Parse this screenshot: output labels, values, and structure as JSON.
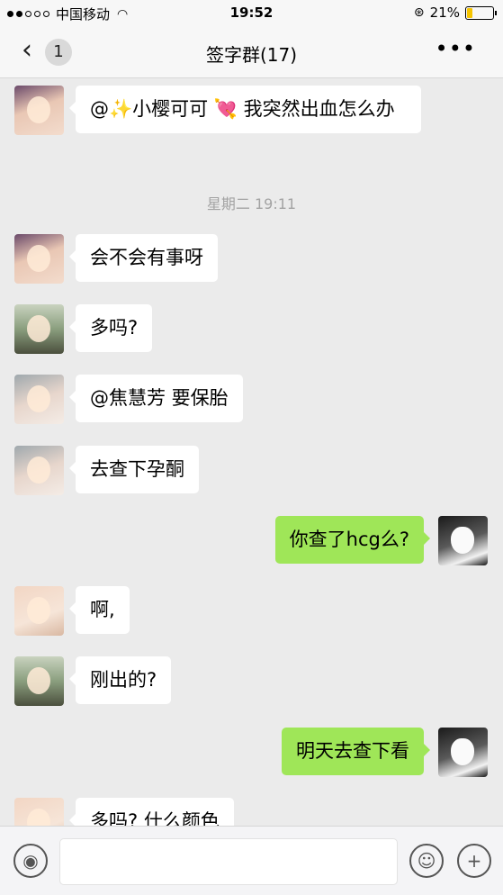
{
  "status_bar": {
    "carrier": "中国移动",
    "time": "19:52",
    "battery": "21%"
  },
  "nav": {
    "badge_count": "1",
    "title": "签字群(17)"
  },
  "chat": {
    "timestamp": "星期二 19:11",
    "messages": [
      {
        "side": "left",
        "avatar": "girl-avatar",
        "text": "@✨小樱可可 💘 我突然出血怎么办"
      },
      {
        "side": "left",
        "avatar": "girl-avatar",
        "text": "会不会有事呀"
      },
      {
        "side": "left",
        "avatar": "man-avatar",
        "text": "多吗?"
      },
      {
        "side": "left",
        "avatar": "woman-avatar",
        "text": "@焦慧芳 要保胎"
      },
      {
        "side": "left",
        "avatar": "woman-avatar",
        "text": "去查下孕酮"
      },
      {
        "side": "right",
        "avatar": "mask-avatar",
        "text": "你查了hcg么?"
      },
      {
        "side": "left",
        "avatar": "baby-avatar",
        "text": "啊,"
      },
      {
        "side": "left",
        "avatar": "man-avatar",
        "text": "刚出的?"
      },
      {
        "side": "right",
        "avatar": "mask-avatar",
        "text": "明天去查下看"
      },
      {
        "side": "left",
        "avatar": "baby-avatar",
        "text": "多吗? 什么颜色"
      }
    ]
  },
  "input_bar": {
    "icons": [
      "voice-icon",
      "emoji-icon",
      "plus-icon"
    ]
  }
}
